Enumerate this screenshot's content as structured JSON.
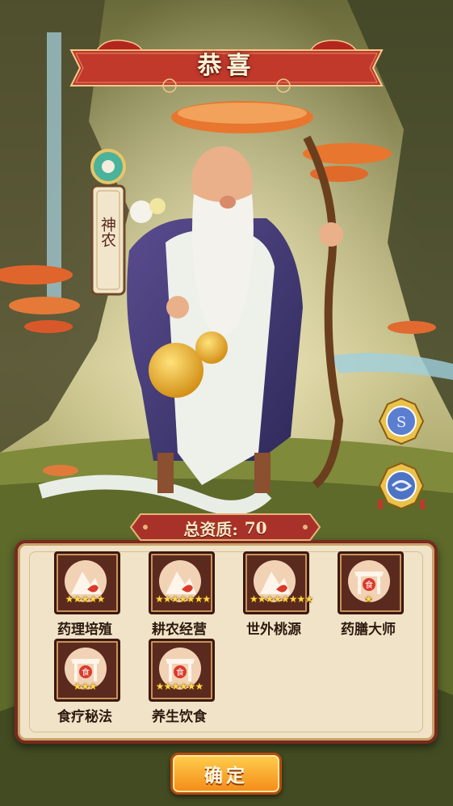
{
  "dialog": {
    "title": "恭喜"
  },
  "hero": {
    "name": "神农"
  },
  "stats": {
    "label": "总资质:",
    "value": "70"
  },
  "skills": [
    {
      "name": "药理培殖",
      "stars": "★★★★★",
      "icon": "herb-mountain-icon"
    },
    {
      "name": "耕农经营",
      "stars": "★★★★★★★",
      "icon": "herb-mountain-icon"
    },
    {
      "name": "世外桃源",
      "stars": "★★★★★★★★",
      "icon": "herb-mountain-icon"
    },
    {
      "name": "药膳大师",
      "stars": "★",
      "icon": "food-stall-icon"
    },
    {
      "name": "食疗秘法",
      "stars": "★★★",
      "icon": "food-stall-icon"
    },
    {
      "name": "养生饮食",
      "stars": "★★★★★★",
      "icon": "food-stall-icon"
    }
  ],
  "buttons": {
    "confirm": "确定"
  },
  "colors": {
    "accent": "#c0392b",
    "gold": "#ffd84a",
    "panel": "#f0e3c7"
  }
}
